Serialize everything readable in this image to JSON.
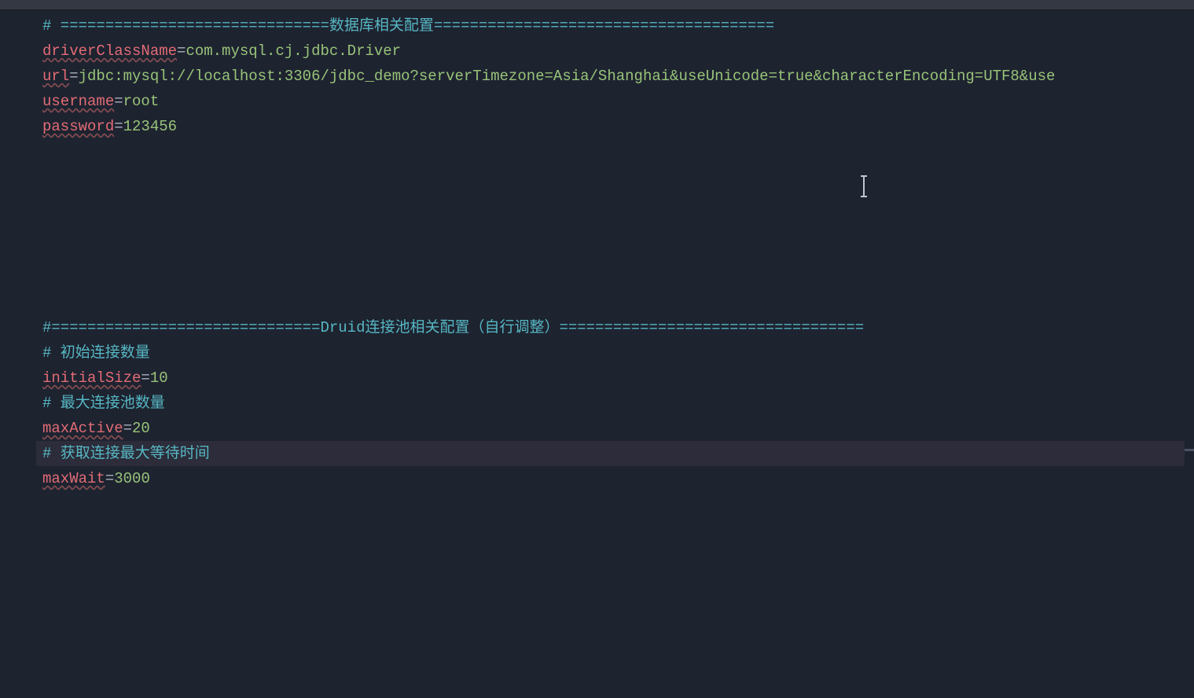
{
  "code": {
    "lines": [
      {
        "type": "comment",
        "text": "# ==============================数据库相关配置======================================"
      },
      {
        "type": "property",
        "key": "driverClassName",
        "value": "com.mysql.cj.jdbc.Driver"
      },
      {
        "type": "property",
        "key": "url",
        "value": "jdbc:mysql://localhost:3306/jdbc_demo?serverTimezone=Asia/Shanghai&useUnicode=true&characterEncoding=UTF8&use"
      },
      {
        "type": "property",
        "key": "username",
        "value": "root"
      },
      {
        "type": "property",
        "key": "password",
        "value": "123456"
      },
      {
        "type": "blank"
      },
      {
        "type": "blank"
      },
      {
        "type": "blank"
      },
      {
        "type": "blank"
      },
      {
        "type": "blank"
      },
      {
        "type": "blank"
      },
      {
        "type": "blank"
      },
      {
        "type": "comment",
        "text": "#==============================Druid连接池相关配置（自行调整）=================================="
      },
      {
        "type": "comment",
        "text": "# 初始连接数量"
      },
      {
        "type": "property",
        "key": "initialSize",
        "value": "10"
      },
      {
        "type": "comment",
        "text": "# 最大连接池数量"
      },
      {
        "type": "property",
        "key": "maxActive",
        "value": "20"
      },
      {
        "type": "comment",
        "highlighted": true,
        "text": "# 获取连接最大等待时间"
      },
      {
        "type": "property",
        "key": "maxWait",
        "value": "3000"
      }
    ]
  },
  "equals_sign": "="
}
